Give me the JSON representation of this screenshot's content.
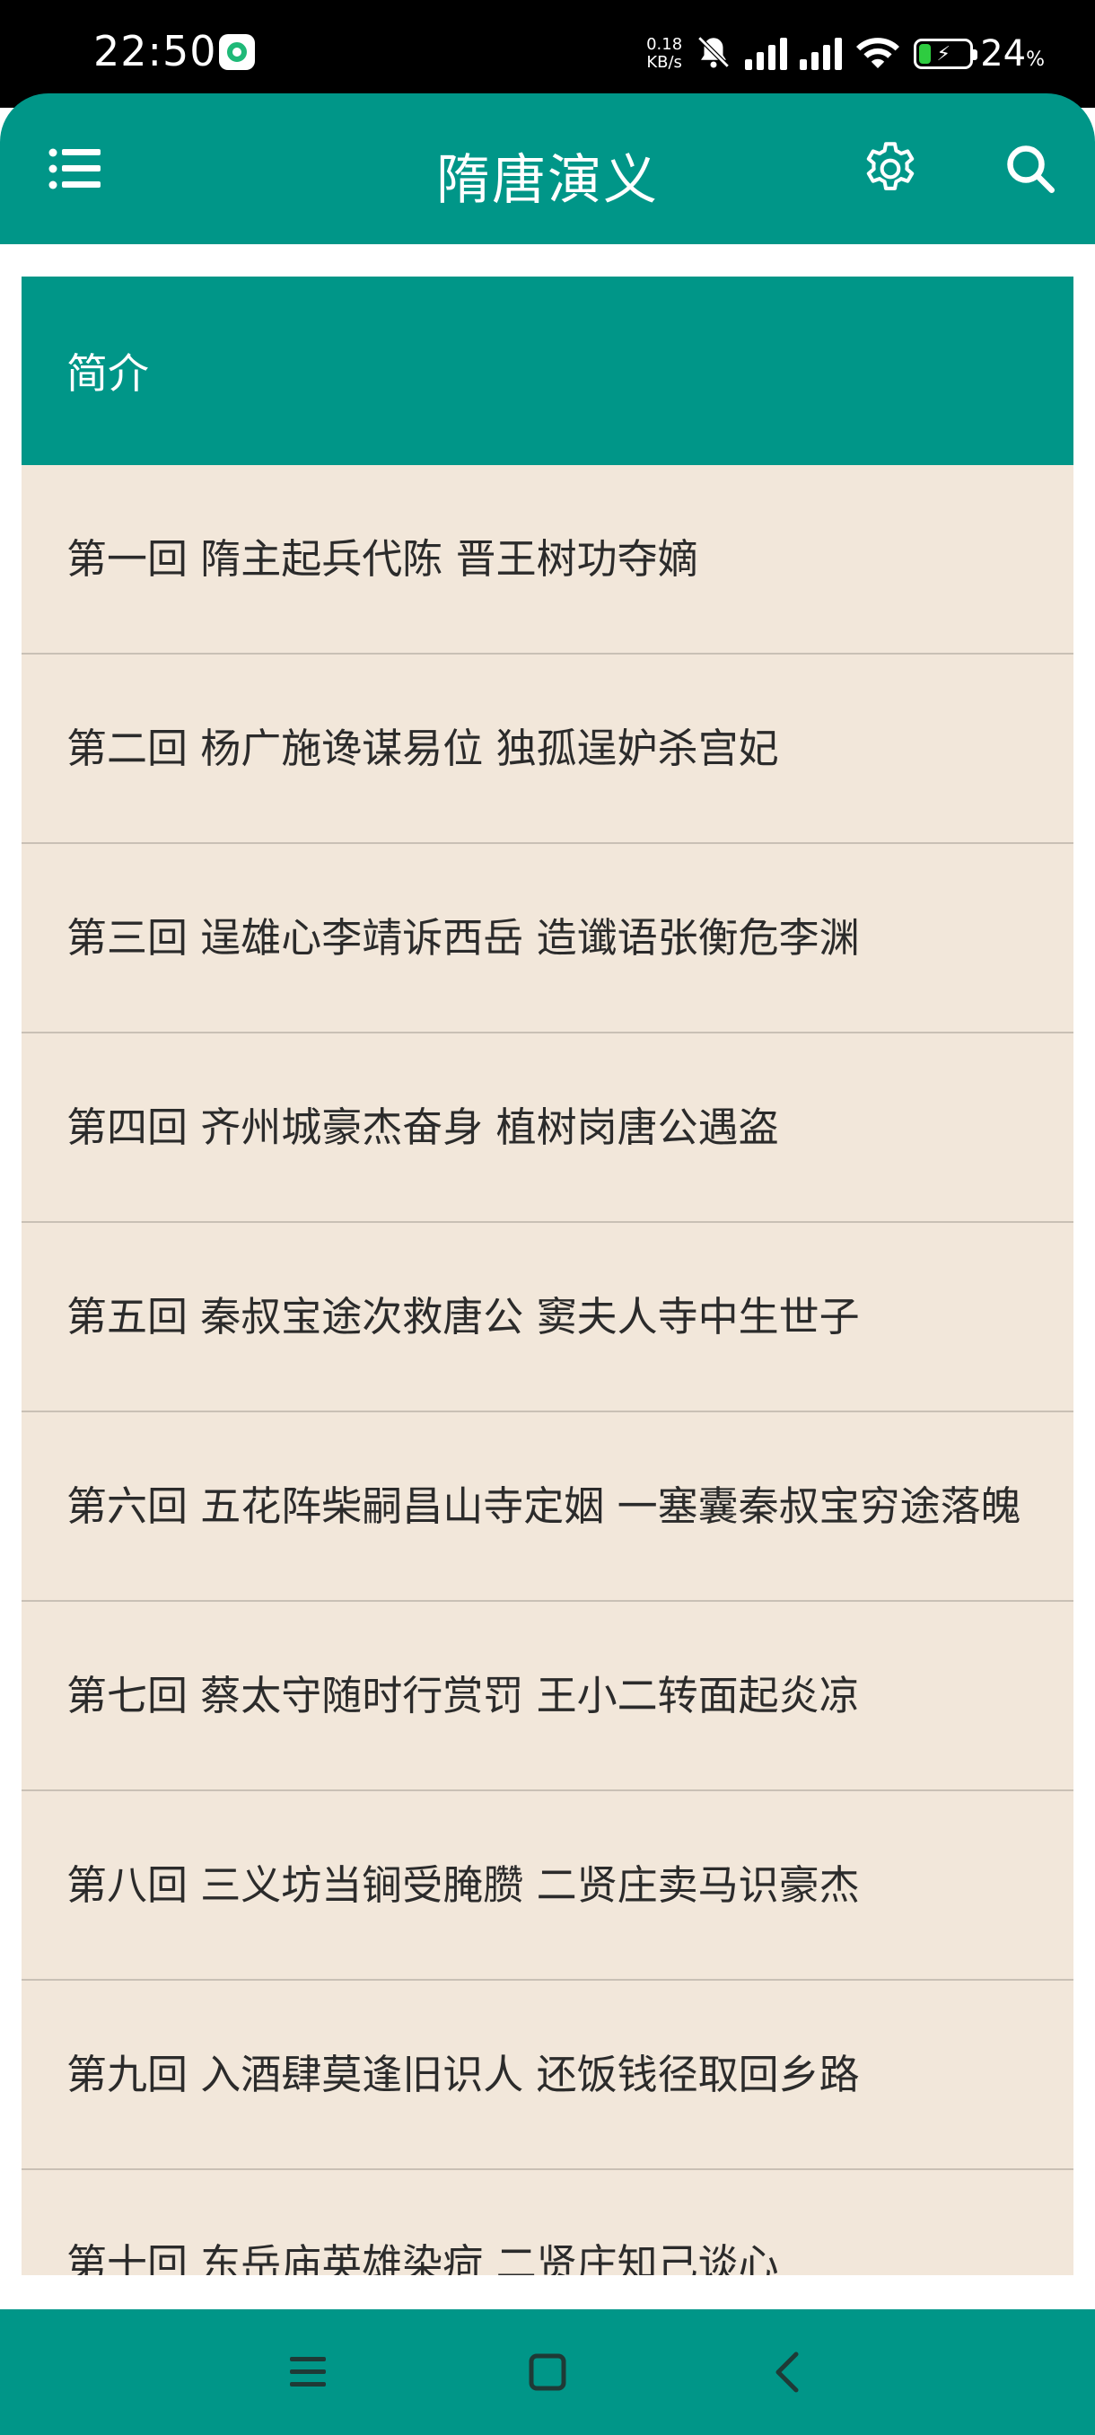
{
  "status_bar": {
    "time": "22:50",
    "net_speed_value": "0.18",
    "net_speed_unit": "KB/s",
    "battery_percent": "24",
    "battery_unit": "%",
    "battery_level": 0.24,
    "colors": {
      "battery_fill": "#2ecc40"
    }
  },
  "app_bar": {
    "title": "隋唐演义",
    "icons": [
      "menu-icon",
      "settings-gear-icon",
      "search-icon"
    ],
    "color": "#009688"
  },
  "chapter_list": {
    "intro_label": "简介",
    "chapters": [
      "第一回 隋主起兵代陈 晋王树功夺嫡",
      "第二回 杨广施谗谋易位 独孤逞妒杀宫妃",
      "第三回 逞雄心李靖诉西岳 造谶语张衡危李渊",
      "第四回 齐州城豪杰奋身 植树岗唐公遇盗",
      "第五回 秦叔宝途次救唐公 窦夫人寺中生世子",
      "第六回 五花阵柴嗣昌山寺定姻 一塞囊秦叔宝穷途落魄",
      "第七回 蔡太守随时行赏罚 王小二转面起炎凉",
      "第八回 三义坊当锏受腌臜 二贤庄卖马识豪杰",
      "第九回 入酒肆莫逢旧识人 还饭钱径取回乡路",
      "第十回 东岳庙英雄染疴 二贤庄知己谈心"
    ],
    "colors": {
      "row_bg": "#f2e7da",
      "divider": "#c9c0b5"
    }
  },
  "nav_bar": {
    "icons": [
      "recent-apps-icon",
      "home-icon",
      "back-icon"
    ]
  }
}
